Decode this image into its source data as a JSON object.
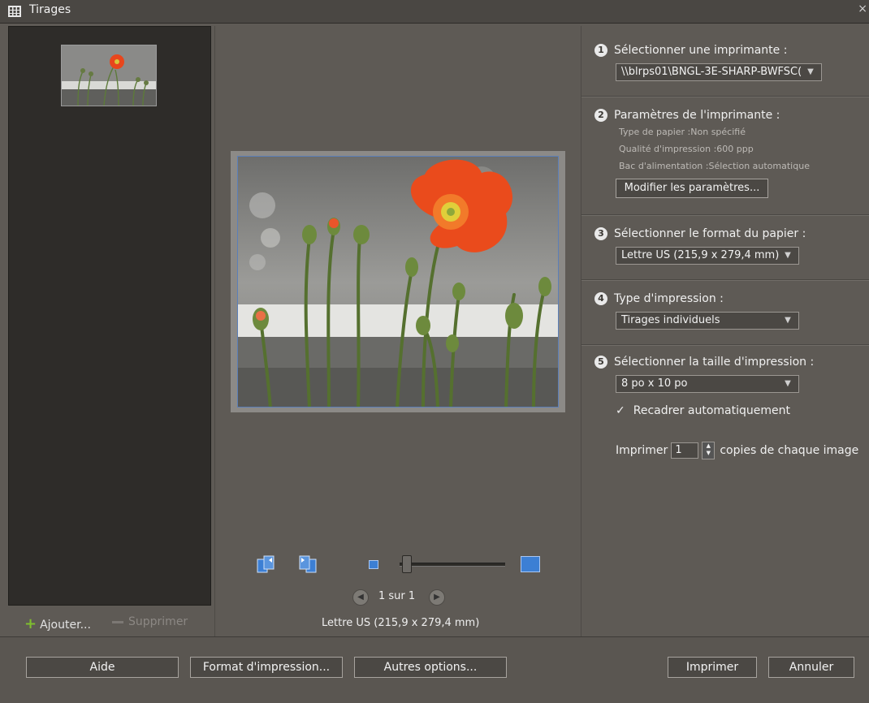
{
  "window": {
    "title": "Tirages",
    "close": "×"
  },
  "left": {
    "add_label": "Ajouter...",
    "remove_label": "Supprimer"
  },
  "preview": {
    "page_label": "1 sur 1",
    "paper_size": "Lettre US (215,9 x 279,4 mm)",
    "zoom_level": 0.05
  },
  "right": {
    "step1": {
      "num": "1",
      "label": "Sélectionner une imprimante :",
      "value": "\\\\blrps01\\BNGL-3E-SHARP-BWFSC("
    },
    "step2": {
      "num": "2",
      "label": "Paramètres de l'imprimante :",
      "paper_type": "Type de papier :Non spécifié",
      "quality": "Qualité d'impression :600 ppp",
      "tray": "Bac d'alimentation :Sélection automatique",
      "button": "Modifier les paramètres..."
    },
    "step3": {
      "num": "3",
      "label": "Sélectionner le format du papier :",
      "value": "Lettre US (215,9 x 279,4 mm)"
    },
    "step4": {
      "num": "4",
      "label": "Type d'impression :",
      "value": "Tirages individuels"
    },
    "step5": {
      "num": "5",
      "label": "Sélectionner la taille d'impression :",
      "value": "8 po x 10 po",
      "crop_label": "Recadrer automatiquement",
      "copies_prefix": "Imprimer",
      "copies_value": "1",
      "copies_suffix": "copies de chaque image"
    }
  },
  "footer": {
    "help": "Aide",
    "page_setup": "Format d'impression...",
    "more_options": "Autres options...",
    "print": "Imprimer",
    "cancel": "Annuler"
  }
}
